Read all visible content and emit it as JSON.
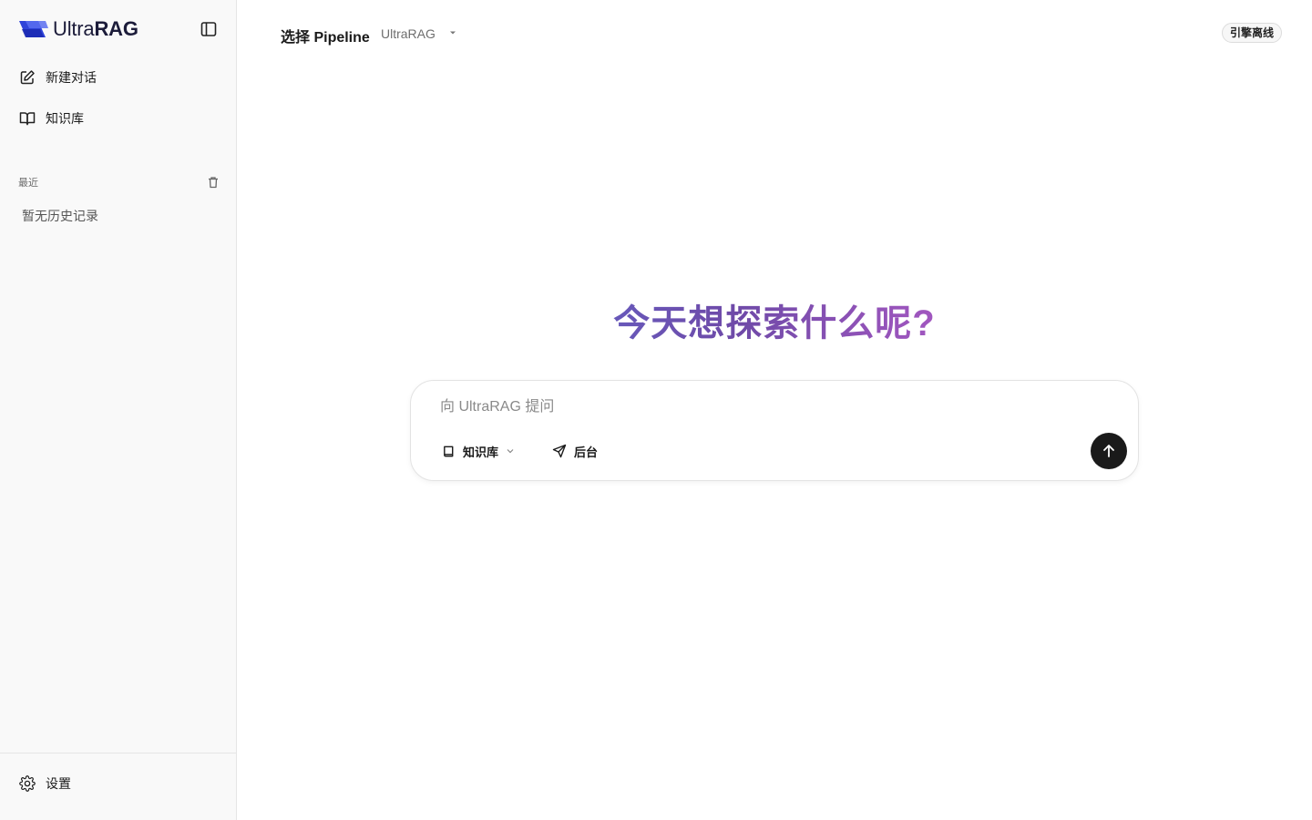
{
  "app": {
    "logo_text_light": "Ultra",
    "logo_text_bold": "RAG",
    "brand_color": "#3b4fe0"
  },
  "sidebar": {
    "nav": [
      {
        "label": "新建对话",
        "icon": "edit-icon"
      },
      {
        "label": "知识库",
        "icon": "book-open-icon"
      }
    ],
    "recent_label": "最近",
    "empty_history": "暂无历史记录",
    "settings_label": "设置"
  },
  "header": {
    "select_pipeline_label": "选择 Pipeline",
    "current_pipeline": "UltraRAG",
    "status": "引擎离线"
  },
  "main": {
    "hero_title": "今天想探索什么呢?",
    "composer": {
      "placeholder": "向 UltraRAG 提问",
      "value": "",
      "kb_label": "知识库",
      "backend_label": "后台"
    }
  }
}
